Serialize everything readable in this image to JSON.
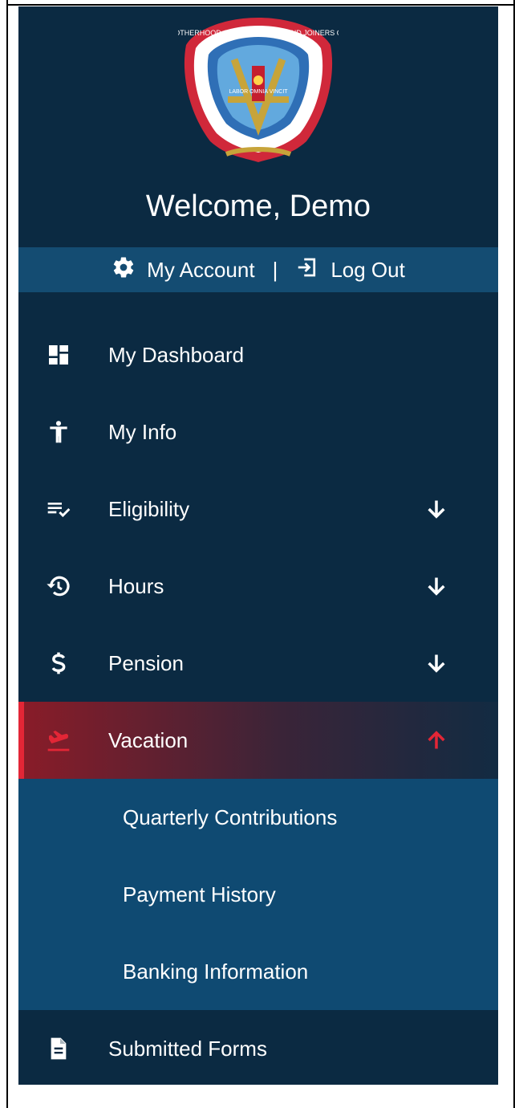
{
  "header": {
    "welcome": "Welcome, Demo",
    "logo_ring_text": "UNITED BROTHERHOOD OF CARPENTERS AND JOINERS OF AMERICA",
    "logo_inner_text": "LABOR OMNIA VINCIT"
  },
  "account_bar": {
    "account_label": "My Account",
    "separator": "|",
    "logout_label": "Log Out",
    "account_icon": "gear-icon",
    "logout_icon": "sign-in-icon"
  },
  "menu": {
    "items": [
      {
        "label": "My Dashboard",
        "icon": "dashboard-icon"
      },
      {
        "label": "My Info",
        "icon": "person-icon"
      },
      {
        "label": "Eligibility",
        "icon": "checklist-icon",
        "arrow": "arrow-down-icon"
      },
      {
        "label": "Hours",
        "icon": "history-icon",
        "arrow": "arrow-down-icon"
      },
      {
        "label": "Pension",
        "icon": "dollar-icon",
        "arrow": "arrow-down-icon"
      },
      {
        "label": "Vacation",
        "icon": "plane-icon",
        "arrow": "arrow-up-icon",
        "active": true
      },
      {
        "label": "Submitted Forms",
        "icon": "document-icon"
      }
    ],
    "vacation_submenu": [
      {
        "label": "Quarterly Contributions"
      },
      {
        "label": "Payment History"
      },
      {
        "label": "Banking Information"
      }
    ]
  },
  "colors": {
    "sidebar_bg": "#0b2a42",
    "account_bar_bg": "#144c72",
    "submenu_bg": "#0f4a72",
    "active_accent": "#e32636"
  }
}
